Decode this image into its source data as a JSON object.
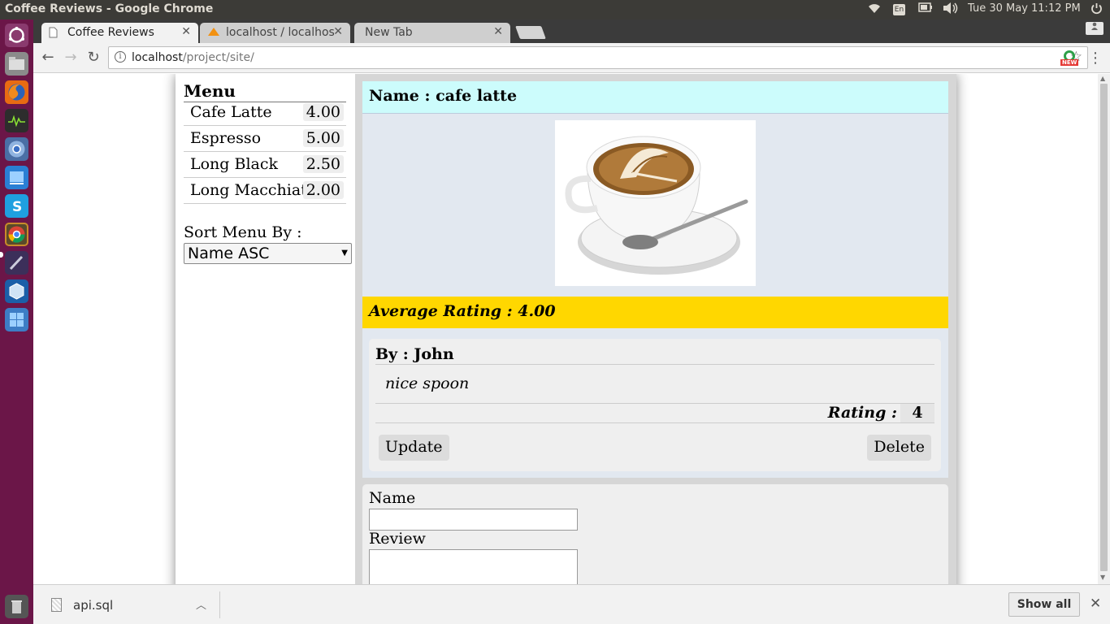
{
  "system_panel": {
    "window_title": "Coffee Reviews - Google Chrome",
    "keyboard_layout": "En",
    "datetime": "Tue 30 May 11:12 PM"
  },
  "launcher": {
    "items": [
      "ubuntu-dash",
      "files",
      "firefox",
      "system-monitor",
      "chromium",
      "workspace",
      "skype",
      "chrome",
      "editor",
      "virtualbox",
      "workspaces"
    ],
    "trash": "trash"
  },
  "browser": {
    "tabs": [
      {
        "label": "Coffee Reviews",
        "icon": "page-icon",
        "active": true
      },
      {
        "label": "localhost / localhos",
        "icon": "phpmyadmin-icon",
        "active": false
      },
      {
        "label": "New Tab",
        "icon": "",
        "active": false
      }
    ],
    "url_host": "localhost",
    "url_path": "/project/site/",
    "extension_badge": "NEW"
  },
  "sidebar": {
    "title": "Menu",
    "items": [
      {
        "name": "Cafe Latte",
        "price": "4.00"
      },
      {
        "name": "Espresso",
        "price": "5.00"
      },
      {
        "name": "Long Black",
        "price": "2.50"
      },
      {
        "name": "Long Macchiato",
        "price": "2.00"
      }
    ],
    "sort_label": "Sort Menu By :",
    "sort_value": "Name ASC"
  },
  "detail": {
    "name_heading": "Name : cafe latte",
    "average_rating": "Average Rating : 4.00",
    "review": {
      "by": "By : John",
      "text": "nice spoon",
      "rating_label": "Rating :",
      "rating_value": "4",
      "update_label": "Update",
      "delete_label": "Delete"
    }
  },
  "form": {
    "name_label": "Name",
    "review_label": "Review",
    "name_value": "",
    "review_value": ""
  },
  "downloads": {
    "file_name": "api.sql",
    "show_all_label": "Show all"
  },
  "colors": {
    "name_header_bg": "#ccfcfc",
    "rating_bar_bg": "#ffd700",
    "launcher_bg": "#6b1648"
  }
}
